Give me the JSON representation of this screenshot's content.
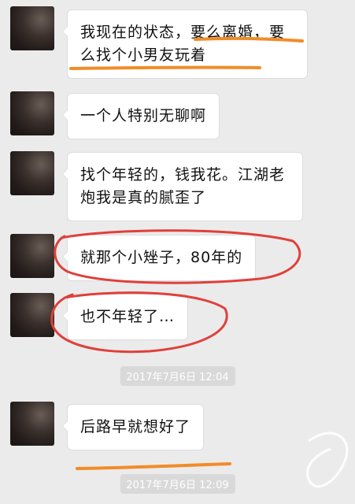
{
  "messages": [
    {
      "text": "我现在的状态，要么离婚，要么找个小男友玩着"
    },
    {
      "text": "一个人特别无聊啊"
    },
    {
      "text": "找个年轻的，钱我花。江湖老炮我是真的腻歪了"
    },
    {
      "text": "就那个小矬子，80年的"
    },
    {
      "text": "也不年轻了…"
    },
    {
      "text": "后路早就想好了"
    }
  ],
  "timestamps": [
    "2017年7月6日 12:04",
    "2017年7月6日 12:09"
  ],
  "colors": {
    "underline": "#f28c28",
    "circle": "#e0403a"
  }
}
